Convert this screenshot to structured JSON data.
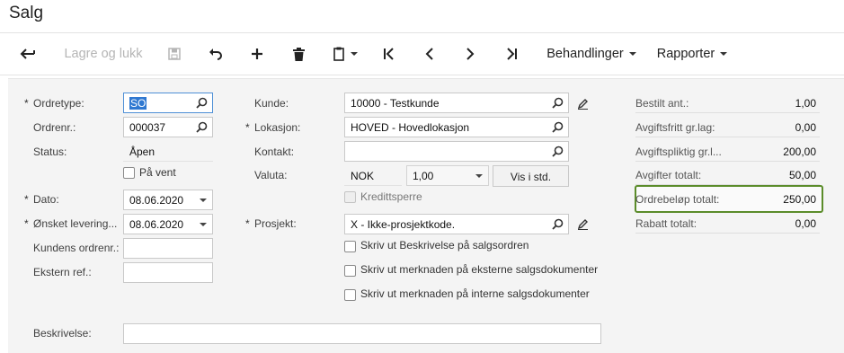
{
  "page": {
    "title": "Salg"
  },
  "toolbar": {
    "save_close": "Lagre og lukk",
    "actions": "Behandlinger",
    "reports": "Rapporter"
  },
  "form": {
    "ordertype": {
      "label": "Ordretype:",
      "value": "SO"
    },
    "orderno": {
      "label": "Ordrenr.:",
      "value": "000037"
    },
    "status": {
      "label": "Status:",
      "value": "Åpen"
    },
    "on_hold": {
      "label": "På vent"
    },
    "date": {
      "label": "Dato:",
      "value": "08.06.2020"
    },
    "requested": {
      "label": "Ønsket levering...",
      "value": "08.06.2020"
    },
    "customer_order": {
      "label": "Kundens ordrenr.:",
      "value": ""
    },
    "external_ref": {
      "label": "Ekstern ref.:",
      "value": ""
    },
    "customer": {
      "label": "Kunde:",
      "value": "10000 - Testkunde"
    },
    "location": {
      "label": "Lokasjon:",
      "value": "HOVED - Hovedlokasjon"
    },
    "contact": {
      "label": "Kontakt:",
      "value": ""
    },
    "currency": {
      "label": "Valuta:",
      "code": "NOK",
      "rate": "1,00",
      "button": "Vis i std."
    },
    "credit_hold": {
      "label": "Kredittsperre"
    },
    "project": {
      "label": "Prosjekt:",
      "value": "X - Ikke-prosjektkode."
    },
    "print_desc": {
      "label": "Skriv ut Beskrivelse på salgsordren"
    },
    "print_note_ext": {
      "label": "Skriv ut merknaden på eksterne salgsdokumenter"
    },
    "print_note_int": {
      "label": "Skriv ut merknaden på interne salgsdokumenter"
    },
    "description": {
      "label": "Beskrivelse:",
      "value": ""
    }
  },
  "totals": [
    {
      "label": "Bestilt ant.:",
      "value": "1,00"
    },
    {
      "label": "Avgiftsfritt gr.lag:",
      "value": "0,00"
    },
    {
      "label": "Avgiftspliktig gr.l...",
      "value": "200,00"
    },
    {
      "label": "Avgifter totalt:",
      "value": "50,00"
    },
    {
      "label": "Ordrebeløp totalt:",
      "value": "250,00"
    },
    {
      "label": "Rabatt totalt:",
      "value": "0,00"
    }
  ],
  "colors": {
    "highlight": "#5b8c2a",
    "focus": "#4d8fd6",
    "selection": "#2f78d1"
  }
}
